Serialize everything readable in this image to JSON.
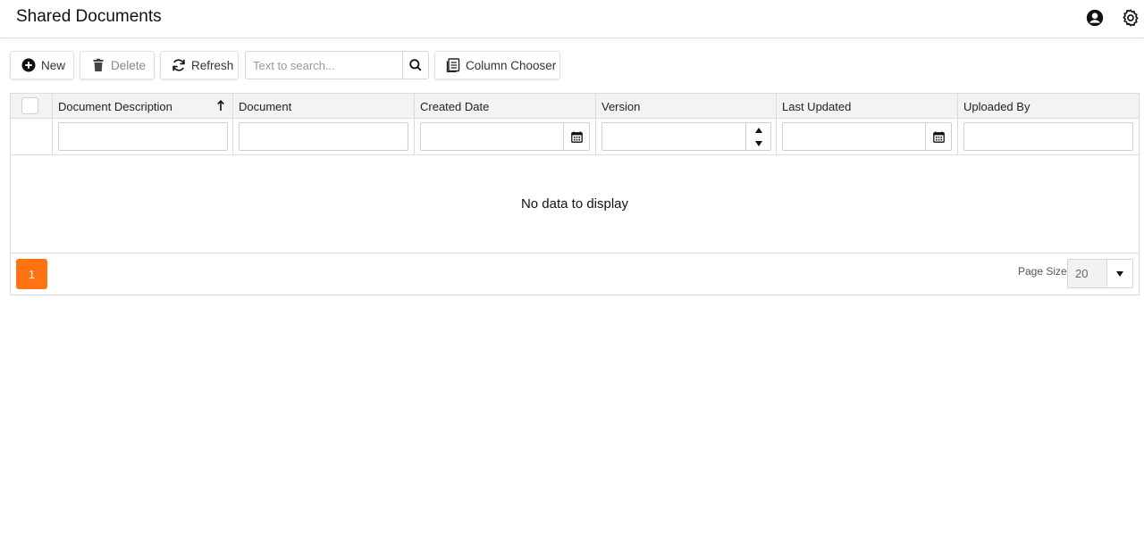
{
  "header": {
    "title": "Shared Documents",
    "icons": [
      "user-circle-icon",
      "gear-icon"
    ]
  },
  "toolbar": {
    "new_label": "New",
    "delete_label": "Delete",
    "refresh_label": "Refresh",
    "search_placeholder": "Text to search...",
    "column_chooser_label": "Column Chooser"
  },
  "grid": {
    "columns": [
      {
        "label": "Document Description",
        "sorted": "ascending"
      },
      {
        "label": "Document"
      },
      {
        "label": "Created Date",
        "filter_editor": "date"
      },
      {
        "label": "Version",
        "filter_editor": "spin"
      },
      {
        "label": "Last Updated",
        "filter_editor": "date"
      },
      {
        "label": "Uploaded By"
      }
    ],
    "empty_text": "No data to display"
  },
  "pager": {
    "current_page": "1",
    "page_size_label": "Page Size:",
    "page_size_value": "20"
  },
  "colors": {
    "accent": "#ff7410",
    "header_bg": "#f3f3f3",
    "border": "#dcdcdc"
  }
}
